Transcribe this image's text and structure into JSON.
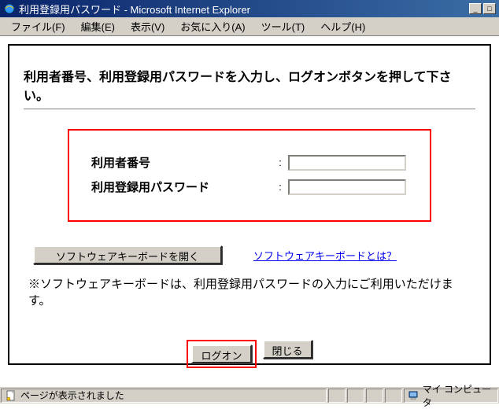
{
  "window": {
    "title": "利用登録用パスワード - Microsoft Internet Explorer"
  },
  "menu": {
    "file": "ファイル(F)",
    "edit": "編集(E)",
    "view": "表示(V)",
    "favorites": "お気に入り(A)",
    "tools": "ツール(T)",
    "help": "ヘルプ(H)"
  },
  "page": {
    "heading": "利用者番号、利用登録用パスワードを入力し、ログオンボタンを押して下さい。",
    "form": {
      "user_number_label": "利用者番号",
      "password_label": "利用登録用パスワード",
      "colon": ":",
      "user_number_value": "",
      "password_value": ""
    },
    "sw_keyboard_button": "ソフトウェアキーボードを開く",
    "sw_keyboard_link": "ソフトウェアキーボードとは？",
    "note": "※ソフトウェアキーボードは、利用登録用パスワードの入力にご利用いただけます。",
    "logon_button": "ログオン",
    "close_button": "閉じる"
  },
  "status": {
    "message": "ページが表示されました",
    "zone": "マイ コンピュータ"
  }
}
